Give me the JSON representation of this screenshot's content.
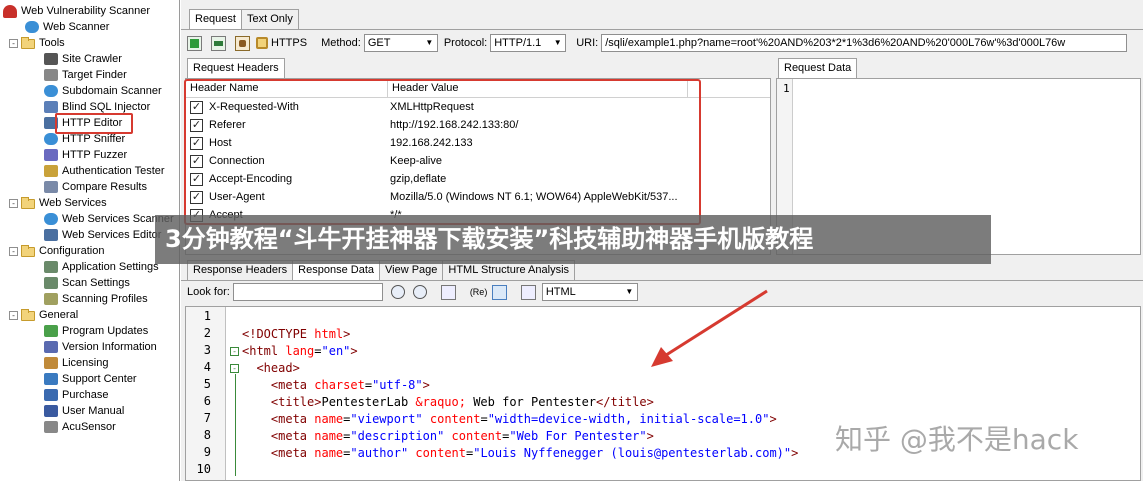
{
  "tree": {
    "root": "Web Vulnerability Scanner",
    "items": [
      {
        "label": "Web Scanner",
        "icon": "globe-icon",
        "depth": 1
      },
      {
        "label": "Tools",
        "icon": "folder-icon",
        "depth": 0,
        "expander": "-"
      },
      {
        "label": "Site Crawler",
        "icon": "spider-icon",
        "depth": 2
      },
      {
        "label": "Target Finder",
        "icon": "magnifier-icon",
        "depth": 2
      },
      {
        "label": "Subdomain Scanner",
        "icon": "globe-icon",
        "depth": 2
      },
      {
        "label": "Blind SQL Injector",
        "icon": "database-icon",
        "depth": 2
      },
      {
        "label": "HTTP Editor",
        "icon": "editor-icon",
        "depth": 2
      },
      {
        "label": "HTTP Sniffer",
        "icon": "globe-icon",
        "depth": 2
      },
      {
        "label": "HTTP Fuzzer",
        "icon": "fuzzer-icon",
        "depth": 2
      },
      {
        "label": "Authentication Tester",
        "icon": "lock-icon",
        "depth": 2
      },
      {
        "label": "Compare Results",
        "icon": "compare-icon",
        "depth": 2
      },
      {
        "label": "Web Services",
        "icon": "folder-icon",
        "depth": 0,
        "expander": "-"
      },
      {
        "label": "Web Services Scanner",
        "icon": "globe-icon",
        "depth": 2
      },
      {
        "label": "Web Services Editor",
        "icon": "editor-icon",
        "depth": 2
      },
      {
        "label": "Configuration",
        "icon": "folder-icon",
        "depth": 0,
        "expander": "-"
      },
      {
        "label": "Application Settings",
        "icon": "settings-icon",
        "depth": 2
      },
      {
        "label": "Scan Settings",
        "icon": "settings-icon",
        "depth": 2
      },
      {
        "label": "Scanning Profiles",
        "icon": "profile-icon",
        "depth": 2
      },
      {
        "label": "General",
        "icon": "folder-icon",
        "depth": 0,
        "expander": "-"
      },
      {
        "label": "Program Updates",
        "icon": "update-icon",
        "depth": 2
      },
      {
        "label": "Version Information",
        "icon": "info-icon",
        "depth": 2
      },
      {
        "label": "Licensing",
        "icon": "license-icon",
        "depth": 2
      },
      {
        "label": "Support Center",
        "icon": "support-icon",
        "depth": 2
      },
      {
        "label": "Purchase",
        "icon": "cart-icon",
        "depth": 2
      },
      {
        "label": "User Manual",
        "icon": "book-icon",
        "depth": 2
      },
      {
        "label": "AcuSensor",
        "icon": "sensor-icon",
        "depth": 2
      }
    ]
  },
  "request_tabs": [
    "Request",
    "Text Only"
  ],
  "toolbar": {
    "https_label": "HTTPS",
    "method_label": "Method:",
    "method_value": "GET",
    "protocol_label": "Protocol:",
    "protocol_value": "HTTP/1.1",
    "uri_label": "URI:",
    "uri_value": "/sqli/example1.php?name=root'%20AND%203*2*1%3d6%20AND%20'000L76w'%3d'000L76w"
  },
  "request_headers": {
    "tab": "Request Headers",
    "col_name": "Header Name",
    "col_value": "Header Value",
    "rows": [
      {
        "name": "X-Requested-With",
        "value": "XMLHttpRequest",
        "checked": true
      },
      {
        "name": "Referer",
        "value": "http://192.168.242.133:80/",
        "checked": true
      },
      {
        "name": "Host",
        "value": "192.168.242.133",
        "checked": true
      },
      {
        "name": "Connection",
        "value": "Keep-alive",
        "checked": true
      },
      {
        "name": "Accept-Encoding",
        "value": "gzip,deflate",
        "checked": true
      },
      {
        "name": "User-Agent",
        "value": "Mozilla/5.0 (Windows NT 6.1; WOW64) AppleWebKit/537...",
        "checked": true
      },
      {
        "name": "Accept",
        "value": "*/*",
        "checked": true
      }
    ]
  },
  "request_data": {
    "tab": "Request Data",
    "line": "1"
  },
  "response_tabs": [
    "Response Headers",
    "Response Data",
    "View Page",
    "HTML Structure Analysis"
  ],
  "response_toolbar": {
    "lookfor_label": "Look for:",
    "lookfor_value": "",
    "syntax_value": "HTML"
  },
  "code": {
    "line_numbers": [
      "1",
      "2",
      "3",
      "4",
      "5",
      "6",
      "7",
      "8",
      "9",
      "10"
    ],
    "lines": [
      {
        "parts": []
      },
      {
        "parts": [
          {
            "c": "tg",
            "t": "<!DOCTYPE "
          },
          {
            "c": "at",
            "t": "html"
          },
          {
            "c": "tg",
            "t": ">"
          }
        ]
      },
      {
        "parts": [
          {
            "c": "tg",
            "t": "<html "
          },
          {
            "c": "at",
            "t": "lang"
          },
          {
            "c": "tx",
            "t": "="
          },
          {
            "c": "st",
            "t": "\"en\""
          },
          {
            "c": "tg",
            "t": ">"
          }
        ]
      },
      {
        "parts": [
          {
            "c": "tg",
            "t": "  <head>"
          }
        ]
      },
      {
        "parts": [
          {
            "c": "tg",
            "t": "    <meta "
          },
          {
            "c": "at",
            "t": "charset"
          },
          {
            "c": "tx",
            "t": "="
          },
          {
            "c": "st",
            "t": "\"utf-8\""
          },
          {
            "c": "tg",
            "t": ">"
          }
        ]
      },
      {
        "parts": [
          {
            "c": "tg",
            "t": "    <title>"
          },
          {
            "c": "tx",
            "t": "PentesterLab "
          },
          {
            "c": "at",
            "t": "&raquo;"
          },
          {
            "c": "tx",
            "t": " Web for Pentester"
          },
          {
            "c": "tg",
            "t": "</title>"
          }
        ]
      },
      {
        "parts": [
          {
            "c": "tg",
            "t": "    <meta "
          },
          {
            "c": "at",
            "t": "name"
          },
          {
            "c": "tx",
            "t": "="
          },
          {
            "c": "st",
            "t": "\"viewport\""
          },
          {
            "c": "tx",
            "t": " "
          },
          {
            "c": "at",
            "t": "content"
          },
          {
            "c": "tx",
            "t": "="
          },
          {
            "c": "st",
            "t": "\"width=device-width, initial-scale=1.0\""
          },
          {
            "c": "tg",
            "t": ">"
          }
        ]
      },
      {
        "parts": [
          {
            "c": "tg",
            "t": "    <meta "
          },
          {
            "c": "at",
            "t": "name"
          },
          {
            "c": "tx",
            "t": "="
          },
          {
            "c": "st",
            "t": "\"description\""
          },
          {
            "c": "tx",
            "t": " "
          },
          {
            "c": "at",
            "t": "content"
          },
          {
            "c": "tx",
            "t": "="
          },
          {
            "c": "st",
            "t": "\"Web For Pentester\""
          },
          {
            "c": "tg",
            "t": ">"
          }
        ]
      },
      {
        "parts": [
          {
            "c": "tg",
            "t": "    <meta "
          },
          {
            "c": "at",
            "t": "name"
          },
          {
            "c": "tx",
            "t": "="
          },
          {
            "c": "st",
            "t": "\"author\""
          },
          {
            "c": "tx",
            "t": " "
          },
          {
            "c": "at",
            "t": "content"
          },
          {
            "c": "tx",
            "t": "="
          },
          {
            "c": "st",
            "t": "\"Louis Nyffenegger (louis@pentesterlab.com)\""
          },
          {
            "c": "tg",
            "t": ">"
          }
        ]
      },
      {
        "parts": []
      }
    ]
  },
  "overlay": {
    "banner": "3分钟教程“斗牛开挂神器下载安装”科技辅助神器手机版教程",
    "watermark": "知乎 @我不是hack"
  },
  "colors": {
    "highlight": "#d63a30",
    "tag": "#800000",
    "attr": "#ff0000",
    "string": "#0000ff"
  }
}
